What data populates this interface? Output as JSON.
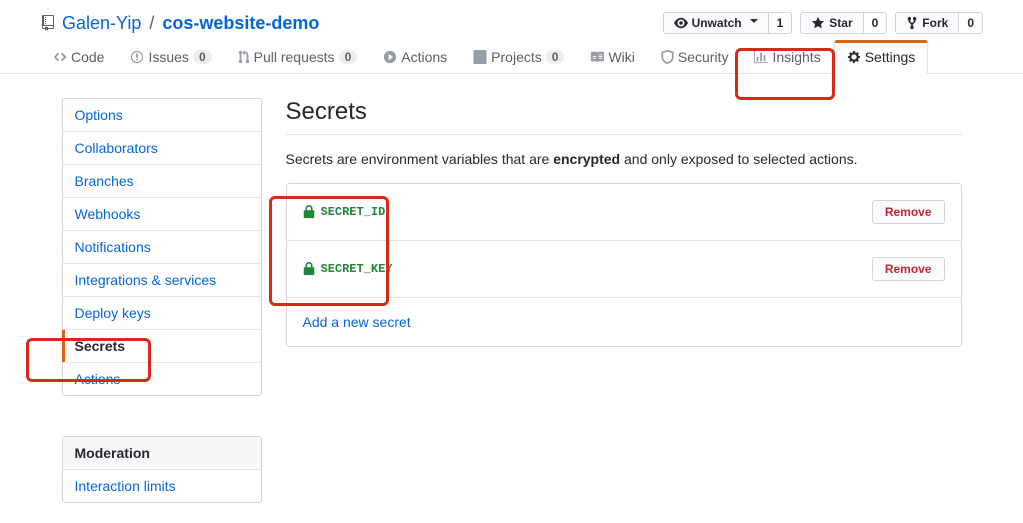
{
  "repo": {
    "owner": "Galen-Yip",
    "name": "cos-website-demo",
    "watch_label": "Unwatch",
    "watch_count": "1",
    "star_label": "Star",
    "star_count": "0",
    "fork_label": "Fork",
    "fork_count": "0"
  },
  "tabs": {
    "code": "Code",
    "issues": "Issues",
    "issues_count": "0",
    "pulls": "Pull requests",
    "pulls_count": "0",
    "actions": "Actions",
    "projects": "Projects",
    "projects_count": "0",
    "wiki": "Wiki",
    "security": "Security",
    "insights": "Insights",
    "settings": "Settings"
  },
  "sidebar": {
    "items": [
      {
        "label": "Options"
      },
      {
        "label": "Collaborators"
      },
      {
        "label": "Branches"
      },
      {
        "label": "Webhooks"
      },
      {
        "label": "Notifications"
      },
      {
        "label": "Integrations & services"
      },
      {
        "label": "Deploy keys"
      },
      {
        "label": "Secrets"
      },
      {
        "label": "Actions"
      }
    ],
    "mod_heading": "Moderation",
    "mod_items": [
      {
        "label": "Interaction limits"
      }
    ]
  },
  "main": {
    "heading": "Secrets",
    "desc_pre": "Secrets are environment variables that are ",
    "desc_strong": "encrypted",
    "desc_post": " and only exposed to selected actions.",
    "secrets": [
      {
        "name": "SECRET_ID",
        "remove": "Remove"
      },
      {
        "name": "SECRET_KEY",
        "remove": "Remove"
      }
    ],
    "add_label": "Add a new secret"
  }
}
